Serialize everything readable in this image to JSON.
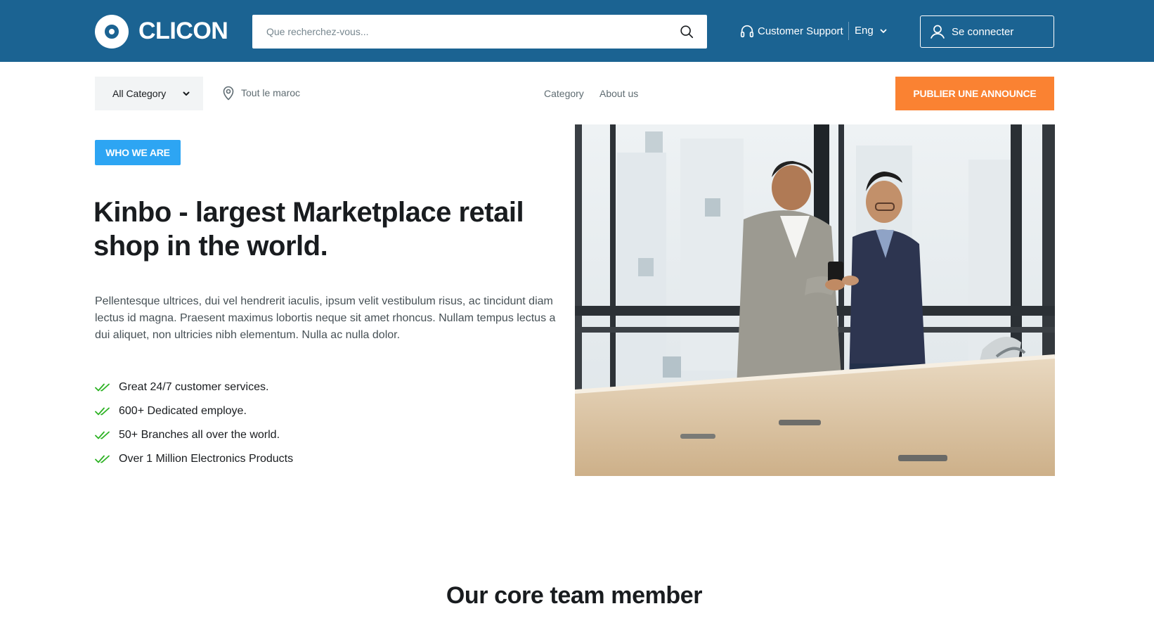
{
  "header": {
    "logo_text": "CLICON",
    "search_placeholder": "Que recherchez-vous...",
    "support_label": "Customer Support",
    "language": "Eng",
    "signin_label": "Se connecter"
  },
  "subnav": {
    "category_select": "All Category",
    "location": "Tout le maroc",
    "links": [
      "Category",
      "About us"
    ],
    "publish_button": "PUBLIER UNE ANNOUNCE"
  },
  "hero": {
    "badge": "WHO WE ARE",
    "title": "Kinbo - largest Marketplace retail shop in the world.",
    "description": "Pellentesque ultrices, dui vel hendrerit iaculis, ipsum velit vestibulum risus, ac tincidunt diam lectus id magna. Praesent maximus lobortis neque sit amet rhoncus. Nullam tempus lectus a dui aliquet, non ultricies nibh elementum. Nulla ac nulla dolor.",
    "features": [
      "Great 24/7 customer services.",
      "600+ Dedicated employe.",
      "50+ Branches all over the world.",
      "Over 1 Million Electronics Products"
    ]
  },
  "team_section": {
    "title": "Our core team member"
  },
  "colors": {
    "header_bg": "#1b6392",
    "accent_orange": "#fa8232",
    "badge_blue": "#2da5f3",
    "check_green": "#2db224"
  },
  "icons": {
    "search": "search-icon",
    "support": "headphones-icon",
    "language": "chevron-down-icon",
    "signin": "user-icon",
    "location": "map-pin-icon",
    "feature": "double-check-icon"
  }
}
